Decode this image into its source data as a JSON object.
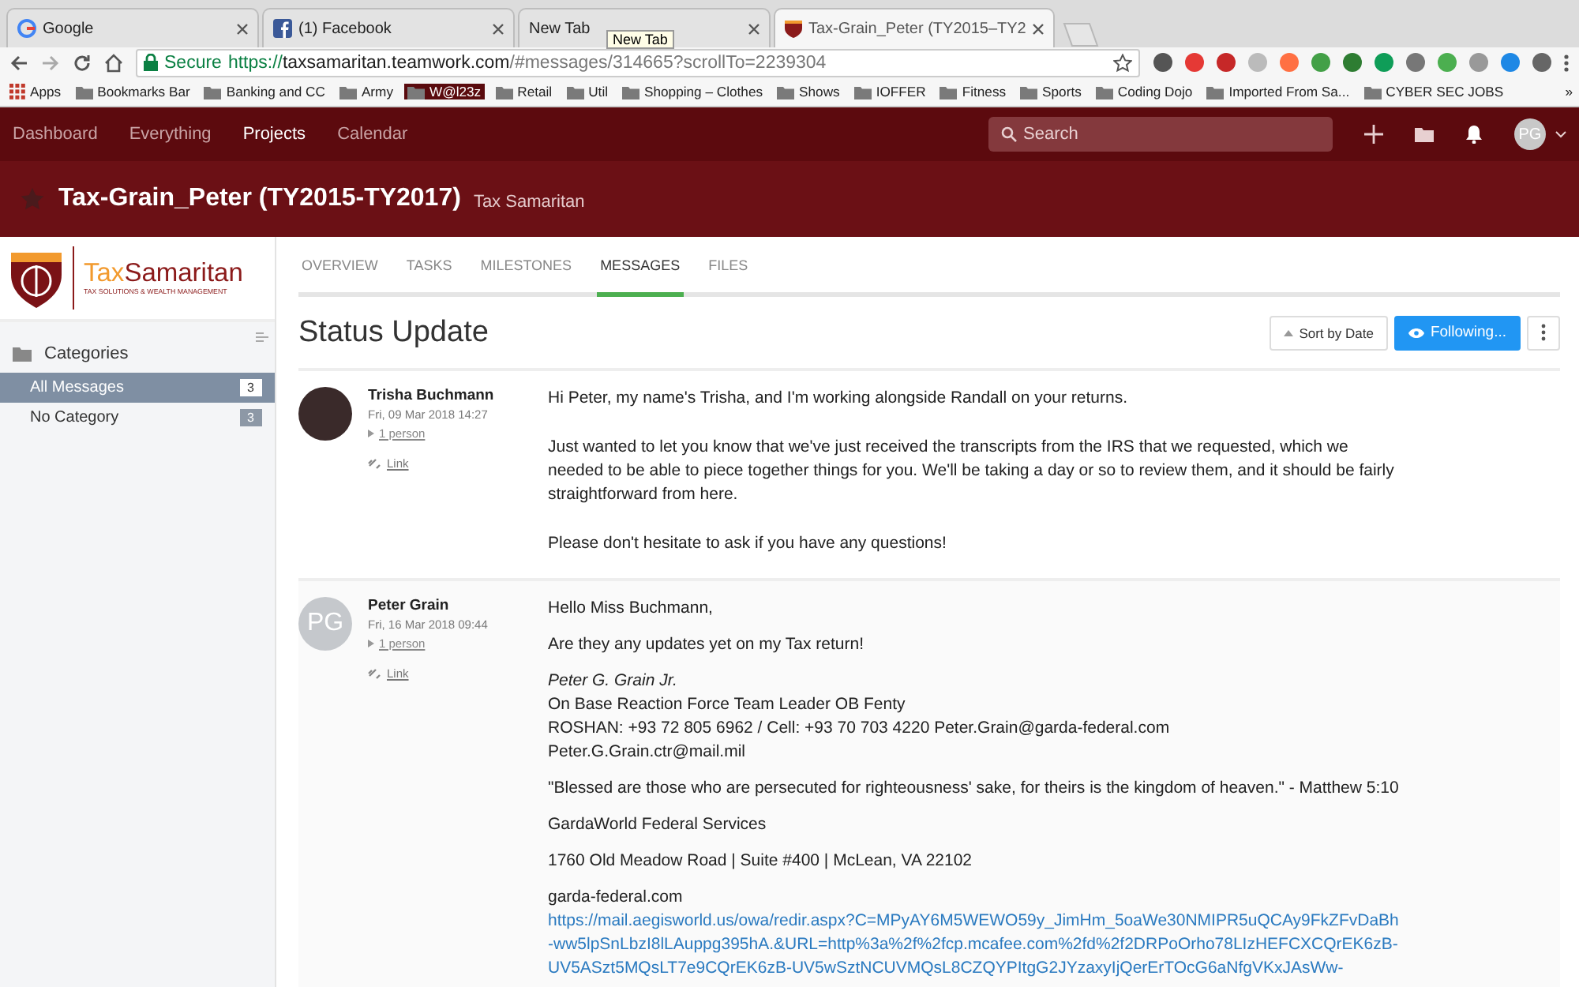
{
  "browser": {
    "tabs": [
      {
        "title": "Google",
        "selected": false
      },
      {
        "title": "(1) Facebook",
        "selected": false
      },
      {
        "title": "New Tab",
        "selected": false
      },
      {
        "title": "Tax-Grain_Peter (TY2015–TY2",
        "selected": true
      }
    ],
    "tooltip": "New Tab",
    "secure_label": "Secure",
    "url_scheme": "https://",
    "url_host": "taxsamaritan.teamwork.com",
    "url_path": "/#messages/314665?scrollTo=2239304",
    "bookmarks": [
      {
        "label": "Apps",
        "kind": "apps",
        "highlighted": false
      },
      {
        "label": "Bookmarks Bar",
        "kind": "folder",
        "highlighted": false
      },
      {
        "label": "Banking and CC",
        "kind": "folder",
        "highlighted": false
      },
      {
        "label": "Army",
        "kind": "folder",
        "highlighted": false
      },
      {
        "label": "W@l23z",
        "kind": "folder",
        "highlighted": true
      },
      {
        "label": "Retail",
        "kind": "folder",
        "highlighted": false
      },
      {
        "label": "Util",
        "kind": "folder",
        "highlighted": false
      },
      {
        "label": "Shopping – Clothes",
        "kind": "folder",
        "highlighted": false
      },
      {
        "label": "Shows",
        "kind": "folder",
        "highlighted": false
      },
      {
        "label": "IOFFER",
        "kind": "folder",
        "highlighted": false
      },
      {
        "label": "Fitness",
        "kind": "folder",
        "highlighted": false
      },
      {
        "label": "Sports",
        "kind": "folder",
        "highlighted": false
      },
      {
        "label": "Coding Dojo",
        "kind": "folder",
        "highlighted": false
      },
      {
        "label": "Imported From Sa...",
        "kind": "folder",
        "highlighted": false
      },
      {
        "label": "CYBER SEC JOBS",
        "kind": "folder",
        "highlighted": false
      }
    ],
    "bookmarks_more": "»"
  },
  "app": {
    "nav": [
      {
        "label": "Dashboard",
        "selected": false
      },
      {
        "label": "Everything",
        "selected": false
      },
      {
        "label": "Projects",
        "selected": true
      },
      {
        "label": "Calendar",
        "selected": false
      }
    ],
    "search": {
      "placeholder": "Search"
    },
    "avatar": "PG"
  },
  "project": {
    "title": "Tax-Grain_Peter (TY2015-TY2017)",
    "company": "Tax Samaritan"
  },
  "sidebar": {
    "logo": {
      "brand_first": "Tax",
      "brand_second": "Samaritan",
      "tagline": "TAX SOLUTIONS & WEALTH MANAGEMENT"
    },
    "heading": "Categories",
    "items": [
      {
        "label": "All Messages",
        "count": "3",
        "selected": true
      },
      {
        "label": "No Category",
        "count": "3",
        "selected": false
      }
    ]
  },
  "tabs": [
    {
      "label": "OVERVIEW",
      "selected": false
    },
    {
      "label": "TASKS",
      "selected": false
    },
    {
      "label": "MILESTONES",
      "selected": false
    },
    {
      "label": "MESSAGES",
      "selected": true
    },
    {
      "label": "FILES",
      "selected": false
    }
  ],
  "page_title": "Status Update",
  "sort_button": "Sort by Date",
  "follow_button": "Following...",
  "messages": [
    {
      "author": "Trisha Buchmann",
      "date": "Fri, 09 Mar 2018 14:27",
      "recipients": "1 person",
      "link": "Link",
      "avatar": {
        "kind": "photo"
      },
      "paragraphs": [
        {
          "lines": [
            "Hi Peter, my name's Trisha, and I'm working alongside Randall on your returns."
          ]
        },
        {
          "lines": [
            "Just wanted to let you know that we've just received the transcripts from the IRS that we requested, which we needed to be able to piece together things for you. We'll be taking a day or so to review them, and it should be fairly straightforward from here."
          ]
        },
        {
          "lines": [
            "Please don't hesitate to ask if you have any questions!"
          ]
        }
      ]
    },
    {
      "author": "Peter Grain",
      "date": "Fri, 16 Mar 2018 09:44",
      "recipients": "1 person",
      "link": "Link",
      "avatar": {
        "kind": "initials",
        "text": "PG"
      },
      "paragraphs": [
        {
          "lines": [
            "Hello Miss Buchmann,"
          ]
        },
        {
          "lines": [
            "Are they any updates yet on my Tax return!"
          ]
        },
        {
          "lines": [
            "*Peter G. Grain Jr.*",
            "On Base Reaction Force Team Leader OB Fenty",
            "ROSHAN: +93 72 805 6962 / Cell: +93 70 703 4220 Peter.Grain@garda-federal.com",
            "Peter.G.Grain.ctr@mail.mil"
          ]
        },
        {
          "lines": [
            "\"Blessed are those who are persecuted for righteousness' sake, for theirs is the kingdom of heaven.\" - Matthew 5:10"
          ]
        },
        {
          "lines": [
            "GardaWorld Federal Services"
          ]
        },
        {
          "lines": [
            "1760 Old Meadow Road | Suite #400 | McLean, VA 22102"
          ]
        },
        {
          "lines": [
            "garda-federal.com"
          ],
          "url": "https://mail.aegisworld.us/owa/redir.aspx?C=MPyAY6M5WEWO59y_JimHm_5oaWe30NMIPR5uQCAy9FkZFvDaBh-ww5lpSnLbzI8lLAuppg395hA.&URL=http%3a%2f%2fcp.mcafee.com%2fd%2f2DRPoOrho78LIzHEFCXCQrEK6zB-UV5ASzt5MQsLT7e9CQrEK6zB-UV5wSztNCUVMQsL8CZQYPItgG2JYzaxyIjQerErTOcG6aNfgVKxJAsWw-"
        }
      ]
    }
  ]
}
